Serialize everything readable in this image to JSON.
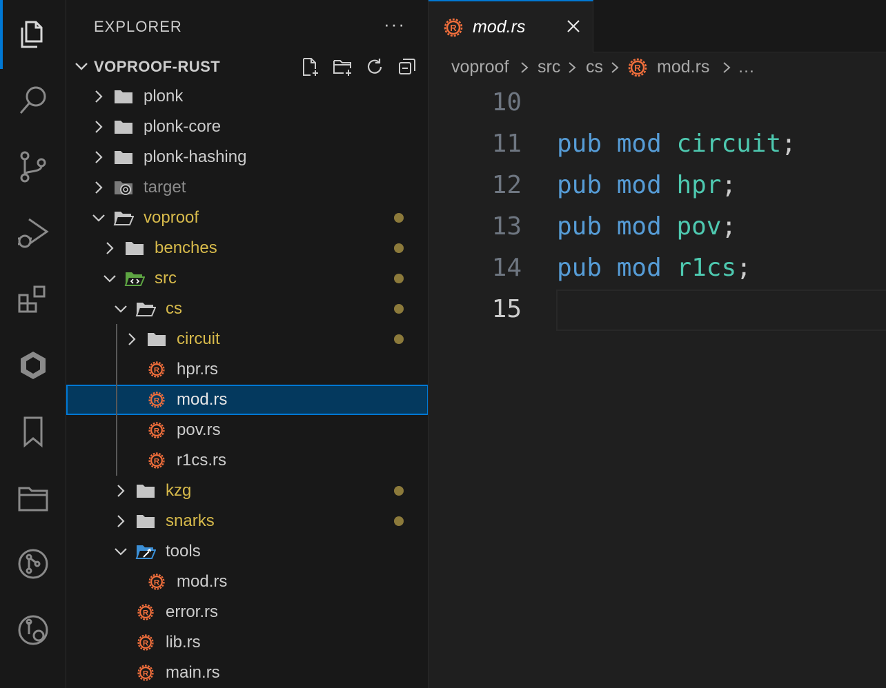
{
  "activity_bar": {
    "items": [
      {
        "name": "explorer-icon",
        "active": true
      },
      {
        "name": "search-icon"
      },
      {
        "name": "source-control-icon"
      },
      {
        "name": "run-debug-icon"
      },
      {
        "name": "extensions-icon"
      },
      {
        "name": "rust-analyzer-icon"
      },
      {
        "name": "bookmarks-icon"
      },
      {
        "name": "project-manager-icon"
      },
      {
        "name": "git-graph-icon"
      },
      {
        "name": "git-history-icon"
      }
    ]
  },
  "sidebar": {
    "title": "EXPLORER",
    "more": "···",
    "project": "VOPROOF-RUST",
    "actions": [
      "new-file-icon",
      "new-folder-icon",
      "refresh-icon",
      "collapse-all-icon"
    ],
    "tree": [
      {
        "label": "plonk",
        "type": "folder",
        "depth": 0,
        "expanded": false,
        "color": "normal"
      },
      {
        "label": "plonk-core",
        "type": "folder",
        "depth": 0,
        "expanded": false,
        "color": "normal"
      },
      {
        "label": "plonk-hashing",
        "type": "folder",
        "depth": 0,
        "expanded": false,
        "color": "normal"
      },
      {
        "label": "target",
        "type": "folder-target",
        "depth": 0,
        "expanded": false,
        "color": "ignored"
      },
      {
        "label": "voproof",
        "type": "folder-open",
        "depth": 0,
        "expanded": true,
        "color": "mod",
        "dot": true
      },
      {
        "label": "benches",
        "type": "folder",
        "depth": 1,
        "expanded": false,
        "color": "mod",
        "dot": true
      },
      {
        "label": "src",
        "type": "folder-src",
        "depth": 1,
        "expanded": true,
        "color": "mod",
        "dot": true
      },
      {
        "label": "cs",
        "type": "folder-open",
        "depth": 2,
        "expanded": true,
        "color": "mod",
        "dot": true
      },
      {
        "label": "circuit",
        "type": "folder",
        "depth": 3,
        "expanded": false,
        "color": "mod",
        "dot": true
      },
      {
        "label": "hpr.rs",
        "type": "rust",
        "depth": 3,
        "color": "normal"
      },
      {
        "label": "mod.rs",
        "type": "rust",
        "depth": 3,
        "color": "white",
        "selected": true
      },
      {
        "label": "pov.rs",
        "type": "rust",
        "depth": 3,
        "color": "normal"
      },
      {
        "label": "r1cs.rs",
        "type": "rust",
        "depth": 3,
        "color": "normal"
      },
      {
        "label": "kzg",
        "type": "folder",
        "depth": 2,
        "expanded": false,
        "color": "mod",
        "dot": true
      },
      {
        "label": "snarks",
        "type": "folder",
        "depth": 2,
        "expanded": false,
        "color": "mod",
        "dot": true
      },
      {
        "label": "tools",
        "type": "folder-tools",
        "depth": 2,
        "expanded": true,
        "color": "normal"
      },
      {
        "label": "mod.rs",
        "type": "rust",
        "depth": 3,
        "color": "normal"
      },
      {
        "label": "error.rs",
        "type": "rust",
        "depth": 2,
        "color": "normal"
      },
      {
        "label": "lib.rs",
        "type": "rust",
        "depth": 2,
        "color": "normal"
      },
      {
        "label": "main.rs",
        "type": "rust",
        "depth": 2,
        "color": "normal"
      }
    ]
  },
  "editor": {
    "tab": {
      "label": "mod.rs"
    },
    "breadcrumbs": [
      "voproof",
      "src",
      "cs",
      "mod.rs",
      "…"
    ],
    "lines": [
      {
        "num": "10",
        "tokens": []
      },
      {
        "num": "11",
        "tokens": [
          [
            "kw",
            "pub"
          ],
          [
            "punc",
            " "
          ],
          [
            "kw",
            "mod"
          ],
          [
            "punc",
            " "
          ],
          [
            "id",
            "circuit"
          ],
          [
            "punc",
            ";"
          ]
        ]
      },
      {
        "num": "12",
        "tokens": [
          [
            "kw",
            "pub"
          ],
          [
            "punc",
            " "
          ],
          [
            "kw",
            "mod"
          ],
          [
            "punc",
            " "
          ],
          [
            "id",
            "hpr"
          ],
          [
            "punc",
            ";"
          ]
        ]
      },
      {
        "num": "13",
        "tokens": [
          [
            "kw",
            "pub"
          ],
          [
            "punc",
            " "
          ],
          [
            "kw",
            "mod"
          ],
          [
            "punc",
            " "
          ],
          [
            "id",
            "pov"
          ],
          [
            "punc",
            ";"
          ]
        ]
      },
      {
        "num": "14",
        "tokens": [
          [
            "kw",
            "pub"
          ],
          [
            "punc",
            " "
          ],
          [
            "kw",
            "mod"
          ],
          [
            "punc",
            " "
          ],
          [
            "id",
            "r1cs"
          ],
          [
            "punc",
            ";"
          ]
        ]
      },
      {
        "num": "15",
        "tokens": [],
        "active": true
      }
    ]
  },
  "colors": {
    "accent": "#0078d4",
    "rust": "#f26f3c",
    "modified": "#d7ba4b",
    "folder": "#c5c5c5"
  }
}
